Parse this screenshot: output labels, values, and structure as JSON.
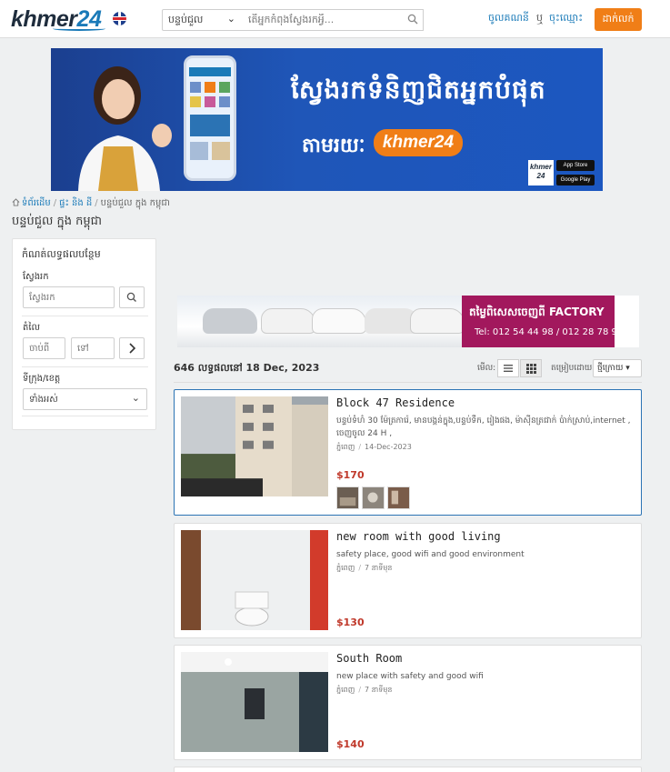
{
  "header": {
    "logo_main": "khmer",
    "logo_num": "24",
    "category_value": "បន្ទប់ជួល",
    "search_placeholder": "តើអ្នកកំពុងស្វែងរកអ្វី...",
    "login": "ចូលគណនី",
    "or": "ឬ",
    "register": "ចុះឈ្មោះ",
    "post_button": "ដាក់លក់"
  },
  "banner": {
    "headline": "ស្វែងរកទំនិញជិតអ្នកបំផុត",
    "via": "តាមរយៈ",
    "brand": "khmer24",
    "mini_logo": "khmer 24",
    "app_store": "App Store",
    "google_play": "Google Play"
  },
  "breadcrumb": {
    "home": "ទំព័រដើម",
    "level2": "ផ្ទះ និង ដី",
    "current": "បន្ទប់ជួល ក្នុង កម្ពុជា",
    "sep": "/"
  },
  "page_title": "បន្ទប់ជួល ក្នុង កម្ពុជា",
  "filter": {
    "title": "កំណត់លទ្ធផលបន្ថែម",
    "search_label": "ស្វែងរក",
    "search_placeholder": "ស្វែងរក",
    "price_label": "តំលៃ",
    "price_from_placeholder": "ចាប់ពី",
    "price_to_placeholder": "ទៅ",
    "province_label": "ទីក្រុង/ខេត្ត",
    "province_value": "ទាំងអស់"
  },
  "ad": {
    "title": "តម្លៃពិសេសចេញពី FACTORY",
    "tel": "Tel: 012 54 44 98 / 012 28 78 99"
  },
  "results": {
    "count_text": "646 លទ្ធផលនៅ 18 Dec, 2023",
    "view_label": "មើល:",
    "sort_label": "តម្រៀបដោយ:",
    "sort_value": "ថ្មីក្រោយ"
  },
  "listings": [
    {
      "title": "Block 47 Residence",
      "description": "បន្ទប់ទំហំ 30 ម៉ែត្រការ៉េ, មានបង្គន់ក្នុង,បន្ទប់ទឹក, រៀងផង, ម៉ាស៊ីនត្រជាក់ ប៉ាក់ស្រាប់,internet , ចេញចូល 24 H ,",
      "location": "ភ្នំពេញ",
      "date": "14-Dec-2023",
      "price": "$170"
    },
    {
      "title": "new room with good living",
      "description": "safety place, good wifi and good environment",
      "location": "ភ្នំពេញ",
      "date": "7 នាទីមុន",
      "price": "$130"
    },
    {
      "title": "South Room",
      "description": "new place with safety and good wifi",
      "location": "ភ្នំពេញ",
      "date": "7 នាទីមុន",
      "price": "$140"
    }
  ]
}
